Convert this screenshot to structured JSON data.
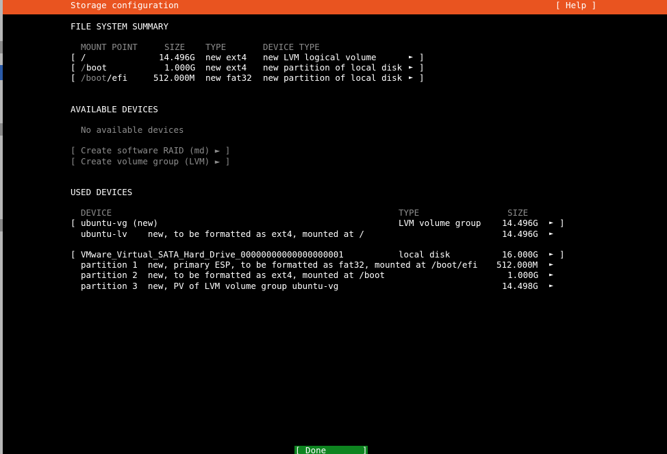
{
  "header": {
    "title": "Storage configuration",
    "help": "[ Help ]",
    "color": "#e95420"
  },
  "fs_summary": {
    "heading": "FILE SYSTEM SUMMARY",
    "columns": [
      "MOUNT POINT",
      "SIZE",
      "TYPE",
      "DEVICE TYPE"
    ],
    "rows": [
      {
        "open": "[",
        "mount_dim": "",
        "mount": "/",
        "size": "14.496G",
        "type": "new ext4",
        "device_type": "new LVM logical volume",
        "arrow": "►",
        "close": "]"
      },
      {
        "open": "[",
        "mount_dim": "/",
        "mount": "boot",
        "size": "1.000G",
        "type": "new ext4",
        "device_type": "new partition of local disk",
        "arrow": "►",
        "close": "]"
      },
      {
        "open": "[",
        "mount_dim": "/boot",
        "mount": "/efi",
        "size": "512.000M",
        "type": "new fat32",
        "device_type": "new partition of local disk",
        "arrow": "►",
        "close": "]"
      }
    ]
  },
  "available_devices": {
    "heading": "AVAILABLE DEVICES",
    "empty_text": "No available devices",
    "actions": [
      "[ Create software RAID (md) ► ]",
      "[ Create volume group (LVM) ► ]"
    ]
  },
  "used_devices": {
    "heading": "USED DEVICES",
    "columns": [
      "DEVICE",
      "TYPE",
      "SIZE"
    ],
    "rows": [
      {
        "open": "[",
        "device": "ubuntu-vg (new)",
        "type": "LVM volume group",
        "size": "14.496G",
        "arrow": "►",
        "close": "]"
      },
      {
        "open": "",
        "device": "ubuntu-lv    new, to be formatted as ext4, mounted at /",
        "type": "",
        "size": "14.496G",
        "arrow": "►",
        "close": ""
      },
      {
        "open": "[",
        "device": "VMware_Virtual_SATA_Hard_Drive_00000000000000000001",
        "type": "local disk",
        "size": "16.000G",
        "arrow": "►",
        "close": "]"
      },
      {
        "open": "",
        "device": "partition 1  new, primary ESP, to be formatted as fat32, mounted at /boot/efi",
        "type": "",
        "size": "512.000M",
        "arrow": "►",
        "close": ""
      },
      {
        "open": "",
        "device": "partition 2  new, to be formatted as ext4, mounted at /boot",
        "type": "",
        "size": "1.000G",
        "arrow": "►",
        "close": ""
      },
      {
        "open": "",
        "device": "partition 3  new, PV of LVM volume group ubuntu-vg",
        "type": "",
        "size": "14.498G",
        "arrow": "►",
        "close": ""
      }
    ]
  },
  "done_button": {
    "label": "[ Done       ]",
    "color": "#0e8420"
  }
}
